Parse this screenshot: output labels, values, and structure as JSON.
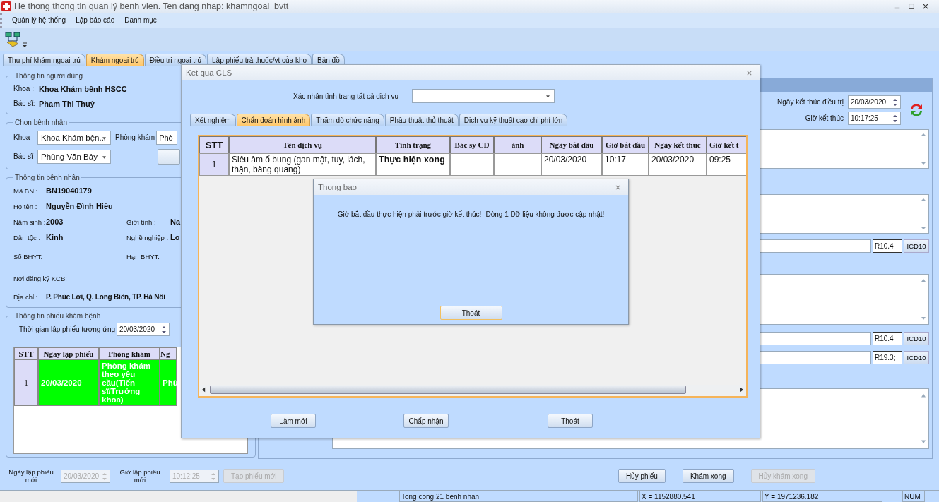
{
  "window": {
    "title": "He thong thong tin quan lý benh vien. Ten dang nhap: khamngoai_bvtt"
  },
  "menu": [
    "Quản lý hệ thống",
    "Lập báo cáo",
    "Danh mục"
  ],
  "main_tabs": [
    {
      "label": "Thu phí khám ngoại trú",
      "selected": false
    },
    {
      "label": "Khám ngoại trú",
      "selected": true
    },
    {
      "label": "Điều trị ngoại trú",
      "selected": false
    },
    {
      "label": "Lập phiếu trả thuốc/vt của kho",
      "selected": false
    },
    {
      "label": "Bản đồ",
      "selected": false
    }
  ],
  "user_info": {
    "title": "Thông tin người dùng",
    "fields": [
      {
        "label": "Khoa :",
        "value": "Khoa Khám bênh  HSCC"
      },
      {
        "label": "Bác sĩ:",
        "value": "Pham Thi Thuỷ"
      }
    ]
  },
  "select_patient": {
    "title": "Chọn bệnh nhân",
    "dept_label": "Khoa",
    "dept_value": "Khoa Khám bện...",
    "room_label": "Phòng khám",
    "room_value": "Phò",
    "doctor_label": "Bác sĩ",
    "doctor_value": "Phùng Văn Bảy"
  },
  "patient_info": {
    "title": "Thông tin bệnh nhân",
    "rows": [
      [
        {
          "label": "Mã BN :",
          "value": "BN19040179"
        }
      ],
      [
        {
          "label": "Họ tên :",
          "value": "Nguyễn Đình Hiếu"
        }
      ],
      [
        {
          "label": "Năm sinh :",
          "value": "2003"
        },
        {
          "label": "Giới tính :",
          "value": "Na"
        }
      ],
      [
        {
          "label": "Dân tộc :",
          "value": "Kinh"
        },
        {
          "label": "Nghề nghiệp :",
          "value": "Lo"
        }
      ],
      [
        {
          "label": "Số BHYT:"
        },
        {
          "label": "Hạn BHYT:"
        }
      ],
      [
        {
          "label": "Nơi đăng ký KCB:"
        }
      ],
      [
        {
          "label": "Địa chỉ :",
          "value": "P. Phúc Lơi, Q. Long Biên, TP. Hà Nôi"
        }
      ]
    ]
  },
  "exam_ticket": {
    "title": "Thông tin phiếu khám bệnh",
    "time_label": "Thời gian lập phiếu tương ứng",
    "time_value": "20/03/2020",
    "columns": [
      "STT",
      "Ngay lập phiếu",
      "Phòng khám",
      "Ng"
    ],
    "rows": [
      {
        "cells": [
          "1",
          "20/03/2020",
          "Phòng khám theo yêu cầu(Tiến sĩ/Trưởng khoa)",
          "Phù"
        ],
        "color": "#00ff00"
      }
    ]
  },
  "new_ticket": {
    "date_label": "Ngày lập phiếu mới",
    "date_value": "20/03/2020",
    "time_label": "Giờ lập phiếu mới",
    "time_value": "10:12:25",
    "button": {
      "label": "Tạo phiếu mới",
      "disabled": true
    }
  },
  "treatment_end": {
    "date_label": "Ngày kết thúc điều trị",
    "date_value": "20/03/2020",
    "time_label": "Giờ kết thúc",
    "time_value": "10:17:25"
  },
  "right_rows": [
    {
      "kind": "textarea"
    },
    {
      "kind": "textarea"
    },
    {
      "kind": "icd",
      "code": "R10.4",
      "button": "ICD10"
    },
    {
      "kind": "textarea"
    },
    {
      "kind": "icd",
      "code": "R10.4",
      "button": "ICD10"
    },
    {
      "kind": "icd",
      "code": "R19.3;",
      "button": "ICD10"
    },
    {
      "kind": "bigtext"
    }
  ],
  "action_buttons": [
    {
      "label": "Hủy phiếu",
      "disabled": false
    },
    {
      "label": "Khám xong",
      "disabled": false
    },
    {
      "label": "Hủy khám xong",
      "disabled": true
    }
  ],
  "status_bar": [
    "Tong cong 21 benh nhan",
    "X = 1152880.541",
    "Y = 1971236.182",
    "NUM"
  ],
  "cls_dialog": {
    "title": "Ket qua CLS",
    "confirm_label": "Xác nhận tình trạng tất cả dịch vụ",
    "tabs": [
      {
        "label": "Xét nghiệm",
        "selected": false
      },
      {
        "label": "Chẩn đoán hình ảnh",
        "selected": true
      },
      {
        "label": "Thăm dò chức năng",
        "selected": false
      },
      {
        "label": "Phẫu thuật thủ thuật",
        "selected": false
      },
      {
        "label": "Dịch vụ kỹ thuật cao chi phí lớn",
        "selected": false
      }
    ],
    "columns": [
      "STT",
      "Tên dịch vụ",
      "Tình trạng",
      "Bác sỹ CĐ",
      "ảnh",
      "Ngày bắt đầu",
      "Giờ bắt đầu",
      "Ngày kết thúc",
      "Giờ kết t"
    ],
    "rows": [
      {
        "cells": [
          {
            "text": "1"
          },
          {
            "text": "Siêu âm ổ bung (gan mật, tuy, lách, thận, bàng quang)"
          },
          {
            "text": "Thực hiện xong"
          },
          {},
          {},
          {
            "text": "20/03/2020"
          },
          {
            "text": "10:17"
          },
          {
            "text": "20/03/2020"
          },
          {
            "text": "09:25"
          }
        ]
      }
    ],
    "buttons": [
      "Làm mới",
      "Chấp nhận",
      "Thoát"
    ]
  },
  "message_dialog": {
    "title": "Thong bao",
    "message": "Giờ bắt đầu thực hiện phải trước giờ kết thúc!- Dòng 1 Dữ liệu không được cập nhật!",
    "button": "Thoát"
  }
}
